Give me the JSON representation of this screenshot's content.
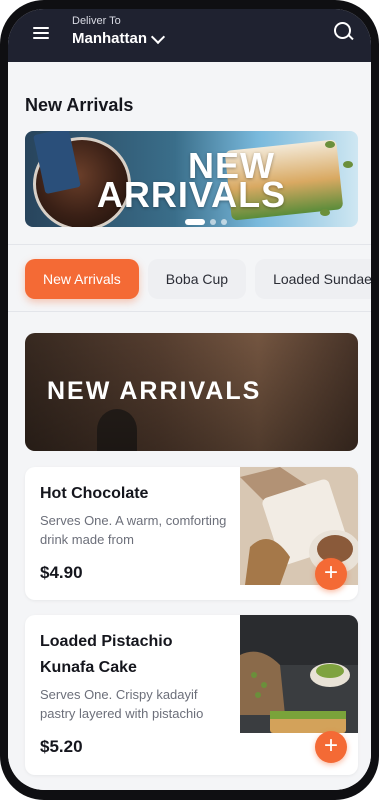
{
  "header": {
    "deliver_label": "Deliver To",
    "location": "Manhattan"
  },
  "arrivals": {
    "title": "New Arrivals",
    "banner_line1": "NEW",
    "banner_line2": "ARRIVALS",
    "carousel_active_index": 0,
    "carousel_count": 3
  },
  "categories": [
    {
      "label": "New Arrivals",
      "active": true
    },
    {
      "label": "Boba Cup",
      "active": false
    },
    {
      "label": "Loaded Sundae",
      "active": false
    }
  ],
  "hero": {
    "title": "NEW ARRIVALS"
  },
  "products": [
    {
      "name": "Hot Chocolate",
      "description": "Serves One. A warm, comforting drink made from",
      "price": "$4.90",
      "add_label": "+"
    },
    {
      "name": "Loaded Pistachio Kunafa Cake",
      "description": "Serves One. Crispy kadayif pastry layered with pistachio",
      "price": "$5.20",
      "add_label": "+"
    }
  ],
  "colors": {
    "accent": "#f46a35",
    "header_bg": "#1f2230"
  },
  "icons": [
    "hamburger-menu-icon",
    "chevron-down-icon",
    "search-icon",
    "plus-icon"
  ]
}
